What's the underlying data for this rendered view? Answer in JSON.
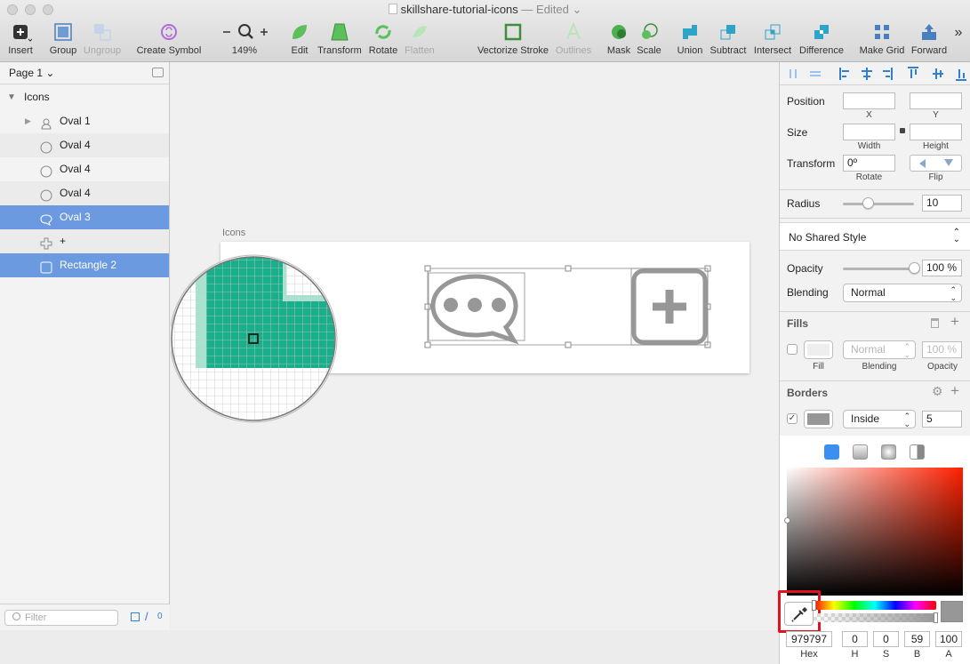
{
  "window": {
    "title": "skillshare-tutorial-icons",
    "edited_suffix": "— Edited ⌄"
  },
  "toolbar": {
    "insert": "Insert",
    "group": "Group",
    "ungroup": "Ungroup",
    "create_symbol": "Create Symbol",
    "zoom_level": "149%",
    "edit": "Edit",
    "transform": "Transform",
    "rotate": "Rotate",
    "flatten": "Flatten",
    "vectorize_stroke": "Vectorize Stroke",
    "outlines": "Outlines",
    "mask": "Mask",
    "scale": "Scale",
    "union": "Union",
    "subtract": "Subtract",
    "intersect": "Intersect",
    "difference": "Difference",
    "make_grid": "Make Grid",
    "forward": "Forward",
    "overflow": "»"
  },
  "sidebar": {
    "page": "Page 1 ⌄",
    "group_name": "Icons",
    "layers": [
      {
        "name": "Oval 1",
        "icon": "person-icon",
        "selected": false
      },
      {
        "name": "Oval 4",
        "icon": "oval-icon",
        "selected": false
      },
      {
        "name": "Oval 4",
        "icon": "oval-icon",
        "selected": false
      },
      {
        "name": "Oval 4",
        "icon": "oval-icon",
        "selected": false
      },
      {
        "name": "Oval 3",
        "icon": "speech-bubble-icon",
        "selected": true
      },
      {
        "name": "+",
        "icon": "plus-shape-icon",
        "selected": false
      },
      {
        "name": "Rectangle 2",
        "icon": "rectangle-icon",
        "selected": true
      }
    ],
    "filter_placeholder": "Filter",
    "filter_count": "0"
  },
  "canvas": {
    "artboard_label": "Icons"
  },
  "inspector": {
    "position_label": "Position",
    "x_label": "X",
    "y_label": "Y",
    "size_label": "Size",
    "width_label": "Width",
    "height_label": "Height",
    "transform_label": "Transform",
    "rotate_value": "0º",
    "rotate_label": "Rotate",
    "flip_label": "Flip",
    "radius_label": "Radius",
    "radius_value": "10",
    "radius_fraction": 0.35,
    "shared_style": "No Shared Style",
    "opacity_label": "Opacity",
    "opacity_value": "100 %",
    "opacity_fraction": 1.0,
    "blending_label": "Blending",
    "blending_value": "Normal",
    "fills_title": "Fills",
    "fill_blend": "Normal",
    "fill_opacity": "100 %",
    "fill_sub": "Fill",
    "fill_blend_sub": "Blending",
    "fill_opacity_sub": "Opacity",
    "borders_title": "Borders",
    "border_position": "Inside",
    "border_thickness": "5",
    "border_color": "#979797"
  },
  "color_picker": {
    "hex": "979797",
    "h": "0",
    "s": "0",
    "b": "59",
    "a": "100",
    "hex_label": "Hex",
    "h_label": "H",
    "s_label": "S",
    "b_label": "B",
    "a_label": "A"
  },
  "colors": {
    "selection": "#6b9ae0",
    "teal": "#1aaf8b",
    "icon_gray": "#979797",
    "highlight_red": "#e0121d"
  }
}
